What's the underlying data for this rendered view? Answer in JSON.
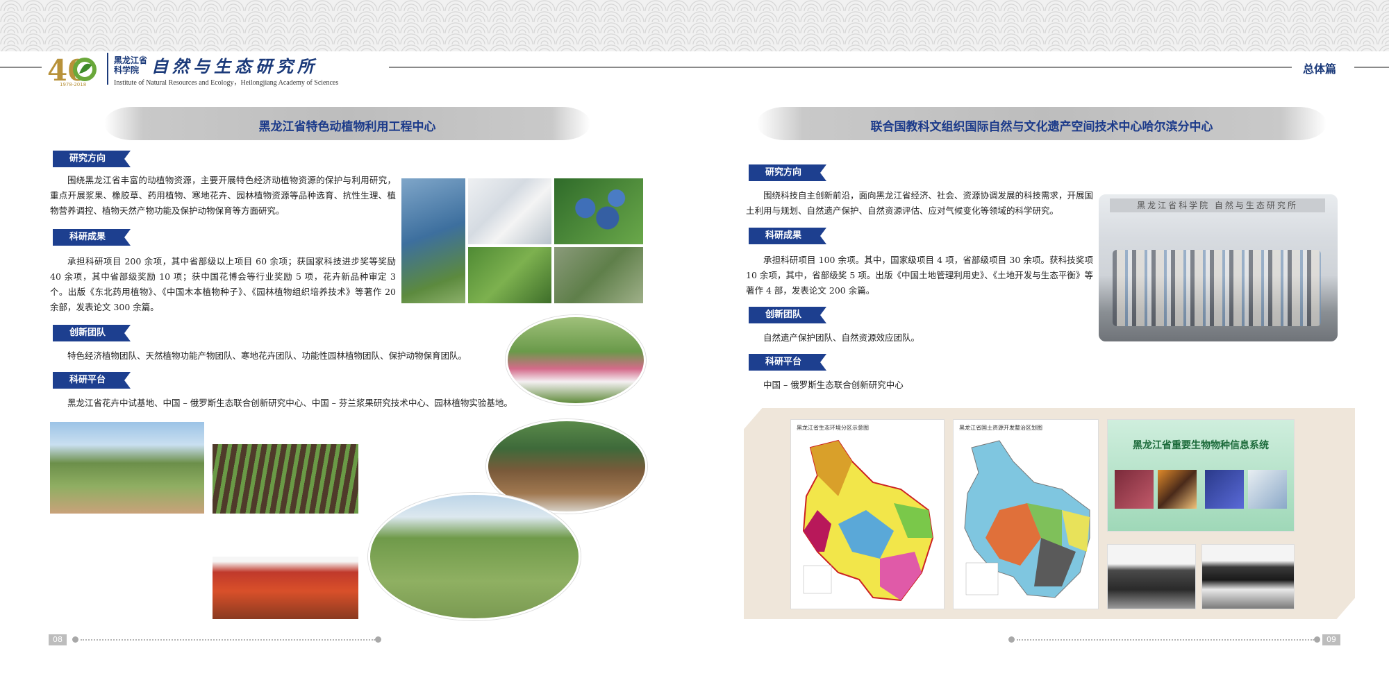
{
  "header": {
    "logo_40_year": "40",
    "logo_years": "1978-2018",
    "logo_org_small": "黑龙江省科学院",
    "logo_org_big": "自然与生态研究所",
    "logo_english": "Institute of Natural Resources and Ecology，Heilongjiang Academy of Sciences",
    "section_label": "总体篇"
  },
  "left_page": {
    "title": "黑龙江省特色动植物利用工程中心",
    "sections": [
      {
        "tag": "研究方向",
        "text": "围绕黑龙江省丰富的动植物资源，主要开展特色经济动植物资源的保护与利用研究，重点开展浆果、橡胶草、药用植物、寒地花卉、园林植物资源等品种选育、抗性生理、植物营养调控、植物天然产物功能及保护动物保育等方面研究。"
      },
      {
        "tag": "科研成果",
        "text": "承担科研项目 200 余项，其中省部级以上项目 60 余项；获国家科技进步奖等奖励 40 余项，其中省部级奖励 10 项；获中国花博会等行业奖励 5 项，花卉新品种审定 3 个。出版《东北药用植物》、《中国木本植物种子》、《园林植物组织培养技术》等著作 20 余部，发表论文 300 余篇。"
      },
      {
        "tag": "创新团队",
        "text": "特色经济植物团队、天然植物功能产物团队、寒地花卉团队、功能性园林植物团队、保护动物保育团队。"
      },
      {
        "tag": "科研平台",
        "text": "黑龙江省花卉中试基地、中国 – 俄罗斯生态联合创新研究中心、中国 – 芬兰浆果研究技术中心、园林植物实验基地。"
      }
    ],
    "page_number": "08"
  },
  "right_page": {
    "title": "联合国教科文组织国际自然与文化遗产空间技术中心哈尔滨分中心",
    "sections": [
      {
        "tag": "研究方向",
        "text": "围绕科技自主创新前沿，面向黑龙江省经济、社会、资源协调发展的科技需求，开展国土利用与规划、自然遗产保护、自然资源评估、应对气候变化等领域的科学研究。"
      },
      {
        "tag": "科研成果",
        "text": "承担科研项目 100 余项。其中，国家级项目 4 项，省部级项目 30 余项。获科技奖项 10 余项，其中，省部级奖 5 项。出版《中国土地管理利用史》、《土地开发与生态平衡》等著作 4 部，发表论文 200 余篇。"
      },
      {
        "tag": "创新团队",
        "text": "自然遗产保护团队、自然资源效应团队。"
      },
      {
        "tag": "科研平台",
        "text": "中国 – 俄罗斯生态联合创新研究中心"
      }
    ],
    "map1_title": "黑龙江省生态环境分区示意图",
    "map2_title": "黑龙江省国土资源开发整治区划图",
    "system_title": "黑龙江省重要生物物种信息系统",
    "building_sign": "黑龙江省科学院 自然与生态研究所",
    "page_number": "09"
  },
  "colors": {
    "brand_blue": "#1d3f8f",
    "title_blue": "#1b3a8a",
    "brush_gray": "#bdbdbd"
  }
}
